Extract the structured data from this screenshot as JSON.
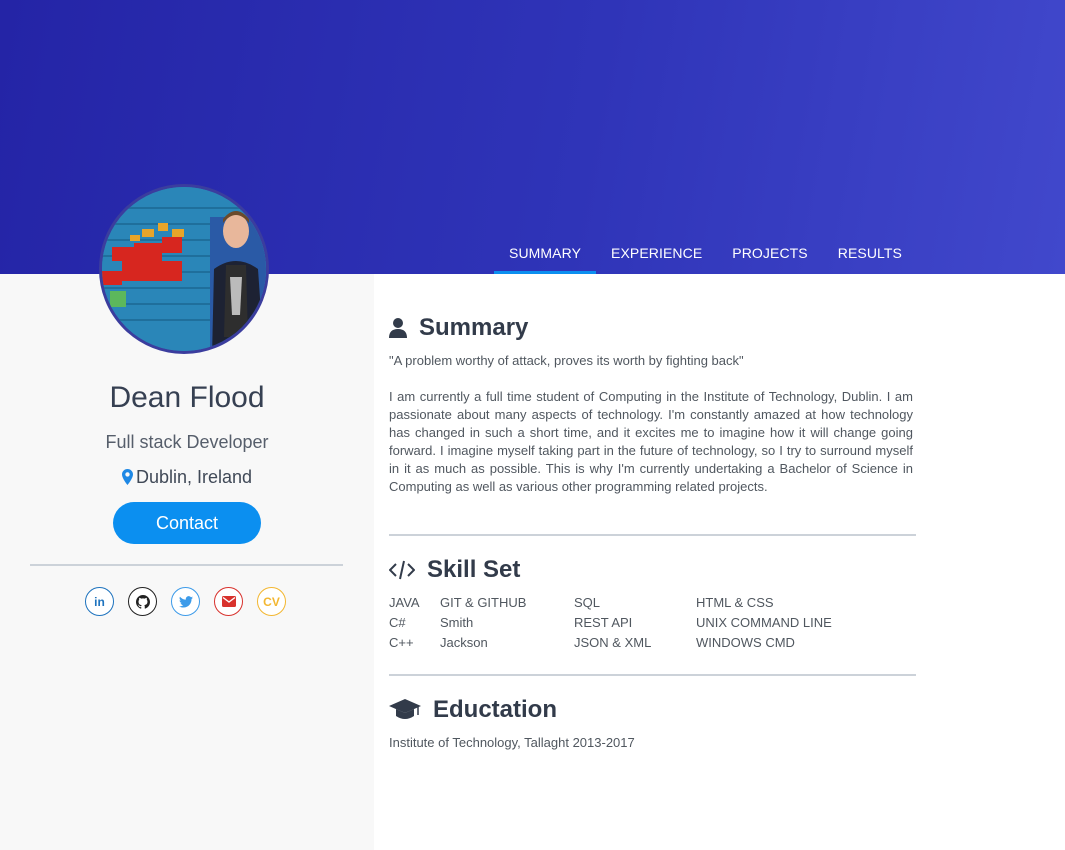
{
  "nav": {
    "items": [
      "SUMMARY",
      "EXPERIENCE",
      "PROJECTS",
      "RESULTS"
    ],
    "active": "SUMMARY"
  },
  "profile": {
    "name": "Dean Flood",
    "role": "Full stack Developer",
    "location": "Dublin, Ireland",
    "contact_label": "Contact"
  },
  "social": {
    "linkedin": "in",
    "cv": "CV"
  },
  "summary": {
    "title": "Summary",
    "quote": "\"A problem worthy of attack, proves its worth by fighting back\"",
    "paragraph": "I am currently a full time student of Computing in the Institute of Technology, Dublin. I am passionate about many aspects of technology. I'm constantly amazed at how technology has changed in such a short time, and it excites me to imagine how it will change going forward. I imagine myself taking part in the future of technology, so I try to surround myself in it as much as possible. This is why I'm currently undertaking a Bachelor of Science in Computing as well as various other programming related projects."
  },
  "skills": {
    "title": "Skill Set",
    "col1": [
      "JAVA",
      "C#",
      "C++"
    ],
    "col2": [
      "GIT & GITHUB",
      "Smith",
      "Jackson"
    ],
    "col3": [
      "SQL",
      "REST API",
      "JSON & XML"
    ],
    "col4": [
      "HTML & CSS",
      "UNIX COMMAND LINE",
      "WINDOWS CMD"
    ]
  },
  "education": {
    "title": "Eductation",
    "text": "Institute of Technology, Tallaght 2013-2017"
  },
  "colors": {
    "accent": "#0b8ff0",
    "hero": "#2f34b8",
    "linkedin": "#1e73be",
    "twitter": "#3d9be9",
    "mail": "#d8322d",
    "cv": "#f3b731"
  },
  "icons": [
    "user-icon",
    "code-icon",
    "graduation-cap-icon",
    "map-marker-icon",
    "linkedin-icon",
    "github-icon",
    "twitter-icon",
    "mail-icon",
    "cv-icon"
  ]
}
